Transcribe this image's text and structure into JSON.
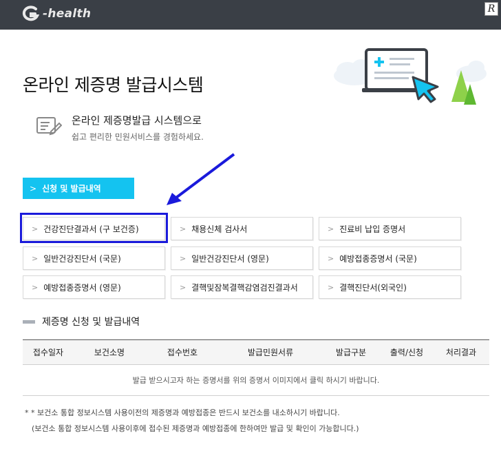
{
  "header": {
    "logo_text": "-health",
    "corner_badge": "R"
  },
  "hero": {
    "title": "온라인 제증명 발급시스템"
  },
  "intro": {
    "title": "온라인 제증명발급 시스템으로",
    "subtitle": "쉽고 편리한 민원서비스를 경험하세요."
  },
  "apply_button": {
    "label": "신청 및 발급내역"
  },
  "certificates": [
    {
      "label": "건강진단결과서 (구 보건증)"
    },
    {
      "label": "채용신체 검사서"
    },
    {
      "label": "진료비 납입 증명서"
    },
    {
      "label": "일반건강진단서 (국문)"
    },
    {
      "label": "일반건강진단서 (영문)"
    },
    {
      "label": "예방접종증명서 (국문)"
    },
    {
      "label": "예방접종증명서 (영문)"
    },
    {
      "label": "결핵및잠복결핵감염검진결과서"
    },
    {
      "label": "결핵진단서(외국인)"
    }
  ],
  "history": {
    "title": "제증명 신청 및 발급내역",
    "columns": [
      "접수일자",
      "보건소명",
      "접수번호",
      "발급민원서류",
      "발급구분",
      "출력/신청",
      "처리결과"
    ],
    "empty_message": "발급 받으시고자 하는 증명서를 위의 증명서 이미지에서 클릭 하시기 바랍니다."
  },
  "notes": {
    "line1": "* * 보건소 통합 정보시스템 사용이전의 제증명과 예방접종은 반드시 보건소를 내소하시기 바랍니다.",
    "line2": "(보건소 통합 정보시스템 사용이후에 접수된 제증명과 예방접종에 한하여만 발급 및 확인이 가능합니다.)"
  },
  "colors": {
    "topbar": "#3a3f46",
    "accent": "#14c3f0",
    "annotation": "#1a1adb"
  }
}
